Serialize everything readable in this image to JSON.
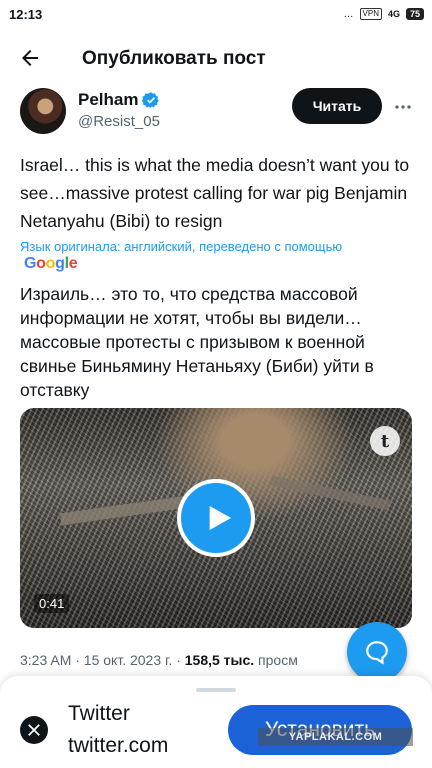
{
  "status_bar": {
    "time": "12:13",
    "indicators": "…",
    "vpn": "VPN",
    "network": "4G",
    "battery": "75"
  },
  "header": {
    "title": "Опубликовать пост",
    "back_icon": "arrow-left-icon"
  },
  "author": {
    "name": "Pelham",
    "handle": "@Resist_05",
    "verified": true,
    "read_button": "Читать"
  },
  "tweet": {
    "text": "Israel… this is what the media doesn’t want you to see…massive protest calling for war pig Benjamin Netanyahu (Bibi) to resign",
    "translation_note": "Язык оригинала: английский, переведено с помощью",
    "translator": "Google",
    "translated_text": "Израиль… это то, что средства массовой информации не хотят, чтобы вы видели… массовые протесты с призывом к военной свинье Биньямину Нетаньяху (Биби) уйти в отставку",
    "video_duration": "0:41",
    "video_badge": "t",
    "meta_time": "3:23 AM · 15 окт. 2023 г. · ",
    "meta_views": "158,5 тыс.",
    "meta_views_suffix": " просм"
  },
  "install_sheet": {
    "app_name": "Twitter",
    "app_domain": "twitter.com",
    "install_button": "Установить"
  },
  "watermark": "YAPLAKAL.COM",
  "colors": {
    "accent": "#1d9bf0",
    "install": "#1a62d6",
    "text_secondary": "#536471"
  }
}
